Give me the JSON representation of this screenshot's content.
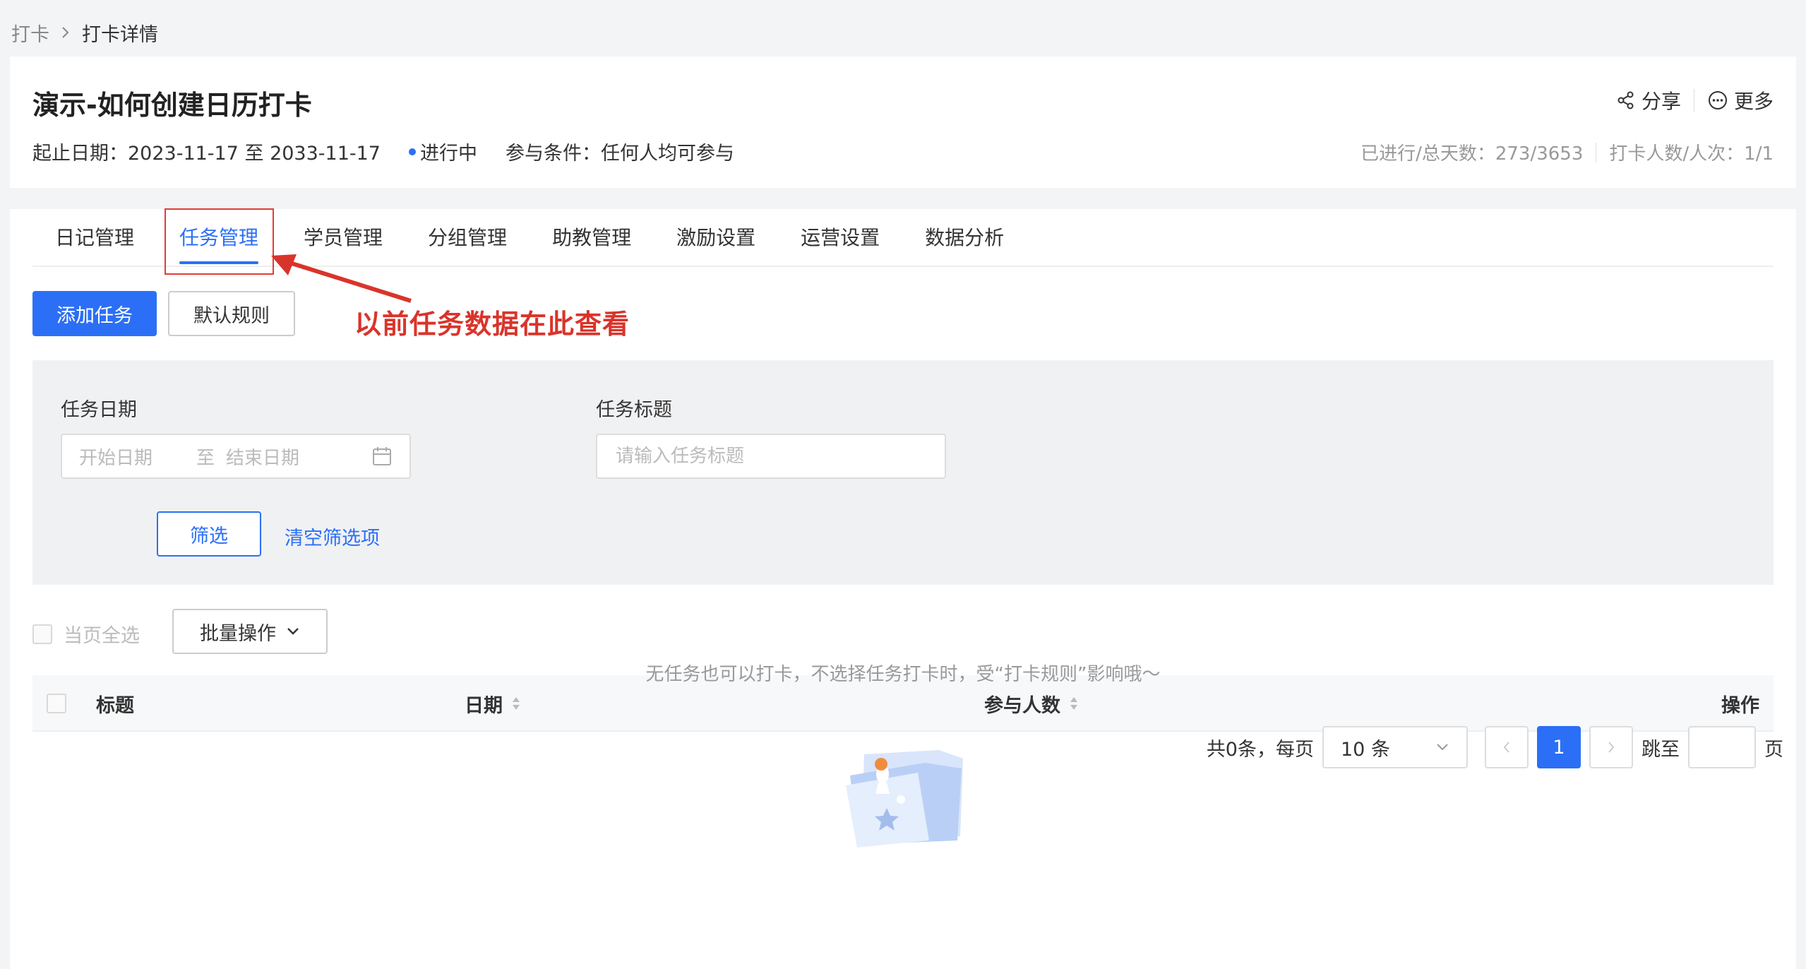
{
  "breadcrumb": {
    "parent": "打卡",
    "current": "打卡详情"
  },
  "header": {
    "title": "演示-如何创建日历打卡",
    "date_range": "起止日期：2023-11-17 至 2033-11-17",
    "status": "进行中",
    "condition": "参与条件：任何人均可参与",
    "share_label": "分享",
    "more_label": "更多",
    "progress_days": "已进行/总天数：273/3653",
    "checkin_count": "打卡人数/人次：1/1"
  },
  "tabs": [
    {
      "label": "日记管理"
    },
    {
      "label": "任务管理"
    },
    {
      "label": "学员管理"
    },
    {
      "label": "分组管理"
    },
    {
      "label": "助教管理"
    },
    {
      "label": "激励设置"
    },
    {
      "label": "运营设置"
    },
    {
      "label": "数据分析"
    }
  ],
  "actions": {
    "add_task": "添加任务",
    "default_rule": "默认规则"
  },
  "annotation": "以前任务数据在此查看",
  "filter": {
    "date_label": "任务日期",
    "start_placeholder": "开始日期",
    "range_to": "至",
    "end_placeholder": "结束日期",
    "title_label": "任务标题",
    "title_placeholder": "请输入任务标题",
    "filter_button": "筛选",
    "clear_link": "清空筛选项"
  },
  "batch": {
    "select_all": "当页全选",
    "batch_ops": "批量操作"
  },
  "table": {
    "columns": [
      "标题",
      "日期",
      "参与人数",
      "操作"
    ],
    "empty_text": "无任务也可以打卡，不选择任务打卡时，受“打卡规则”影响哦～"
  },
  "pagination": {
    "total": "共0条，每页",
    "page_size": "10 条",
    "current_page": "1",
    "jump_label": "跳至",
    "page_suffix": "页"
  },
  "colors": {
    "primary": "#2b6ff6",
    "annotation": "#d9342b"
  }
}
